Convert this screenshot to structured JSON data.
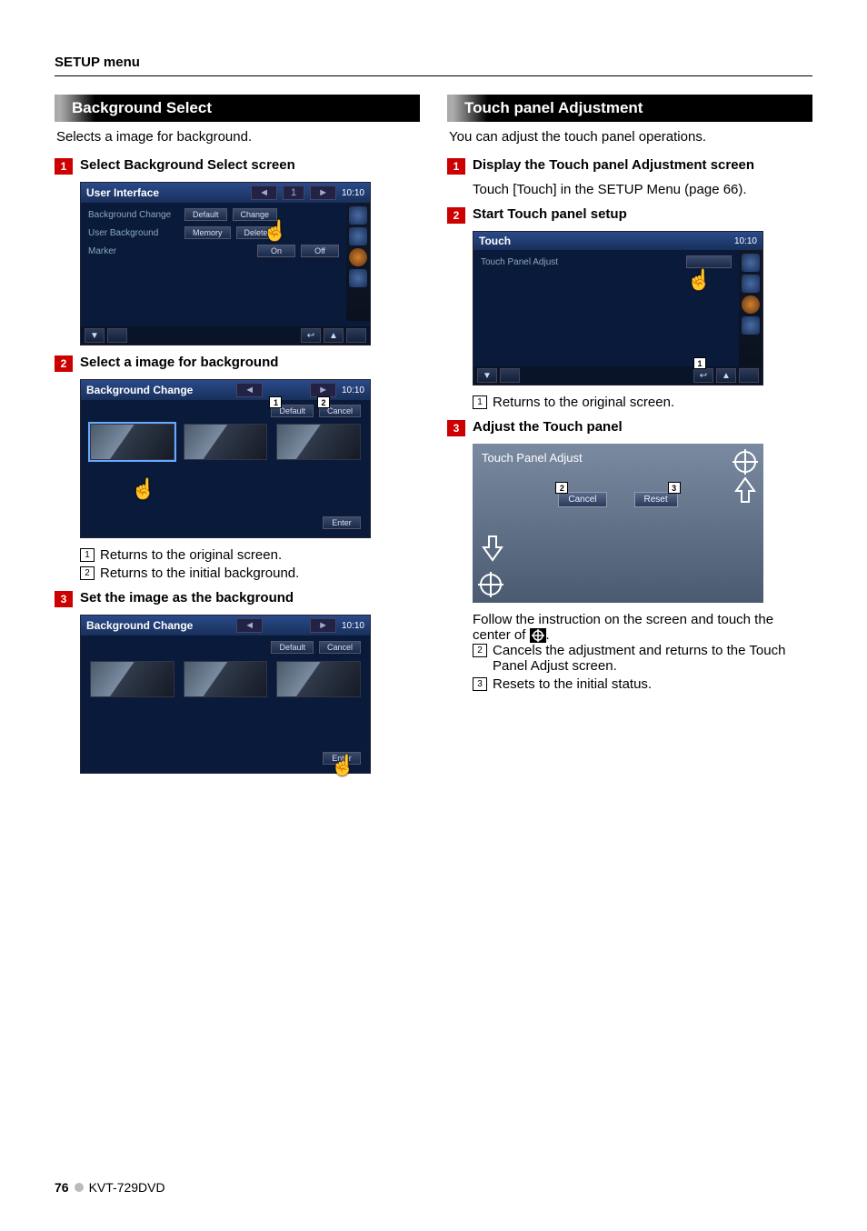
{
  "header": {
    "title": "SETUP menu"
  },
  "footer": {
    "page": "76",
    "model": "KVT-729DVD"
  },
  "left": {
    "section": "Background Select",
    "intro": "Selects a image for background.",
    "step1": {
      "title": "Select Background Select screen",
      "ui": {
        "title": "User Interface",
        "tab": "1",
        "clock": "10:10",
        "rows": {
          "bgchange": {
            "label": "Background Change",
            "btnDefault": "Default",
            "btnChange": "Change"
          },
          "userbg": {
            "label": "User Background",
            "btnMemory": "Memory",
            "btnDelete": "Delete"
          },
          "marker": {
            "label": "Marker",
            "btnOn": "On",
            "btnOff": "Off"
          }
        }
      }
    },
    "step2": {
      "title": "Select a image for background",
      "ui": {
        "title": "Background Change",
        "clock": "10:10",
        "btnDefault": "Default",
        "btnCancel": "Cancel",
        "btnEnter": "Enter"
      },
      "notes": {
        "n1": "Returns to the original screen.",
        "n2": "Returns to the initial background."
      }
    },
    "step3": {
      "title": "Set the image as the background",
      "ui": {
        "title": "Background Change",
        "clock": "10:10",
        "btnDefault": "Default",
        "btnCancel": "Cancel",
        "btnEnter": "Enter"
      }
    }
  },
  "right": {
    "section": "Touch panel Adjustment",
    "intro": "You can adjust the touch panel operations.",
    "step1": {
      "title": "Display the Touch panel Adjustment screen",
      "body": "Touch [Touch] in the SETUP Menu (page 66)."
    },
    "step2": {
      "title": "Start Touch panel setup",
      "ui": {
        "title": "Touch",
        "clock": "10:10",
        "row": {
          "label": "Touch Panel Adjust"
        }
      },
      "notes": {
        "n1": "Returns to the original screen."
      }
    },
    "step3": {
      "title": "Adjust the Touch panel",
      "ui": {
        "title": "Touch Panel Adjust",
        "btnCancel": "Cancel",
        "btnReset": "Reset"
      },
      "body": "Follow the instruction on the screen and touch the center of ",
      "bodyEnd": ".",
      "notes": {
        "n2": "Cancels the adjustment and returns to the Touch Panel Adjust screen.",
        "n3": "Resets to the initial status."
      }
    }
  }
}
